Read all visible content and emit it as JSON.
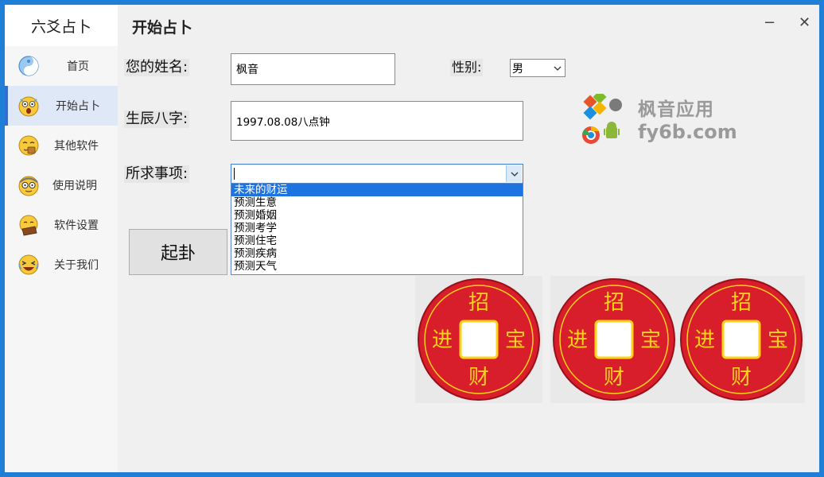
{
  "sidebar": {
    "app_title": "六爻占卜",
    "items": [
      {
        "label": "首页",
        "icon": "yin-yang-icon"
      },
      {
        "label": "开始占卜",
        "icon": "shocked-face-icon"
      },
      {
        "label": "其他软件",
        "icon": "coffee-face-icon"
      },
      {
        "label": "使用说明",
        "icon": "nerd-face-icon"
      },
      {
        "label": "软件设置",
        "icon": "laptop-face-icon"
      },
      {
        "label": "关于我们",
        "icon": "laughing-face-icon"
      }
    ],
    "active_index": 1
  },
  "header": {
    "title": "开始占卜",
    "minimize_glyph": "−",
    "close_glyph": "✕"
  },
  "form": {
    "name_label": "您的姓名:",
    "name_value": "枫音",
    "gender_label": "性别:",
    "gender_value": "男",
    "birth_label": "生辰八字:",
    "birth_value": "1997.08.08八点钟",
    "matter_label": "所求事项:",
    "matter_value": "",
    "matter_options": [
      "未来的财运",
      "预测生意",
      "预测婚姻",
      "预测考学",
      "预测住宅",
      "预测疾病",
      "预测天气"
    ],
    "matter_highlighted_index": 0
  },
  "button": {
    "qi_gua": "起卦"
  },
  "watermark": {
    "line1": "枫音应用",
    "line2": "fy6b.com"
  },
  "coins": [
    {
      "top": "招",
      "left": "进",
      "right": "宝",
      "bottom": "财"
    },
    {
      "top": "招",
      "left": "进",
      "right": "宝",
      "bottom": "财"
    },
    {
      "top": "招",
      "left": "进",
      "right": "宝",
      "bottom": "财"
    }
  ],
  "colors": {
    "accent": "#2f6fd6",
    "coin_red": "#d81e2a",
    "coin_text": "#ffd21a",
    "selection": "#1d74e0"
  }
}
